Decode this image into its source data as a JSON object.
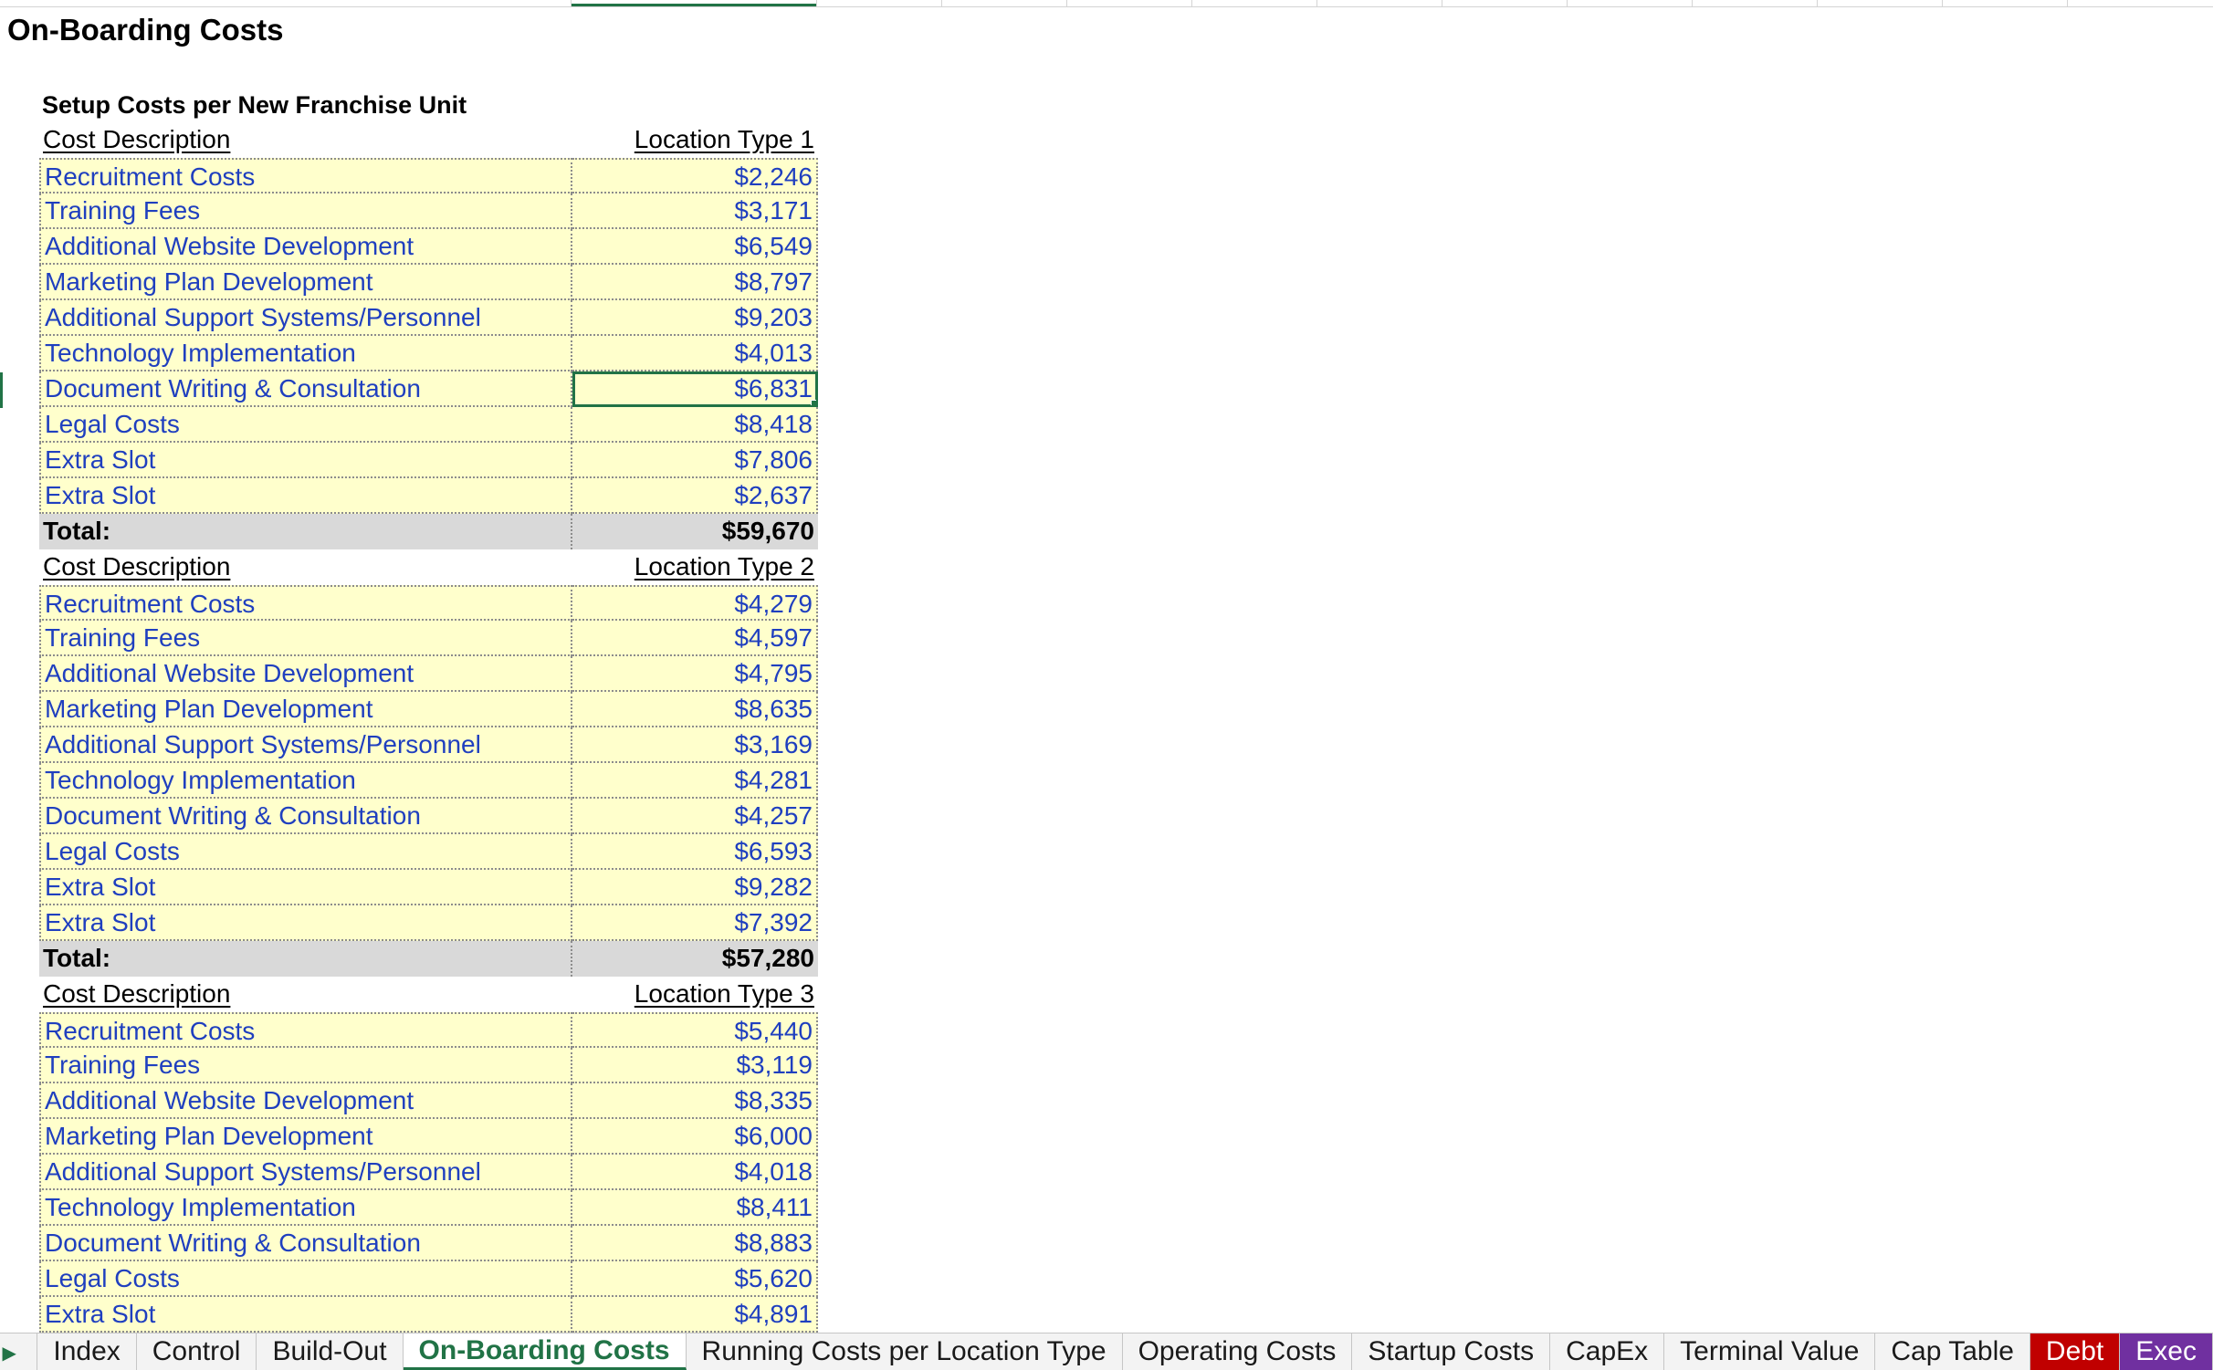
{
  "sheet": {
    "title": "On-Boarding Costs",
    "subtitle": "Setup Costs per New Franchise Unit"
  },
  "tables": [
    {
      "header": {
        "desc": "Cost Description",
        "value": "Location Type 1"
      },
      "rows": [
        {
          "desc": "Recruitment Costs",
          "value": "$2,246"
        },
        {
          "desc": "Training Fees",
          "value": "$3,171"
        },
        {
          "desc": "Additional Website Development",
          "value": "$6,549"
        },
        {
          "desc": "Marketing Plan Development",
          "value": "$8,797"
        },
        {
          "desc": "Additional Support Systems/Personnel",
          "value": "$9,203"
        },
        {
          "desc": "Technology Implementation",
          "value": "$4,013"
        },
        {
          "desc": "Document Writing & Consultation",
          "value": "$6,831"
        },
        {
          "desc": "Legal Costs",
          "value": "$8,418"
        },
        {
          "desc": "Extra Slot",
          "value": "$7,806"
        },
        {
          "desc": "Extra Slot",
          "value": "$2,637"
        }
      ],
      "total": {
        "label": "Total:",
        "value": "$59,670"
      }
    },
    {
      "header": {
        "desc": "Cost Description",
        "value": "Location Type 2"
      },
      "rows": [
        {
          "desc": "Recruitment Costs",
          "value": "$4,279"
        },
        {
          "desc": "Training Fees",
          "value": "$4,597"
        },
        {
          "desc": "Additional Website Development",
          "value": "$4,795"
        },
        {
          "desc": "Marketing Plan Development",
          "value": "$8,635"
        },
        {
          "desc": "Additional Support Systems/Personnel",
          "value": "$3,169"
        },
        {
          "desc": "Technology Implementation",
          "value": "$4,281"
        },
        {
          "desc": "Document Writing & Consultation",
          "value": "$4,257"
        },
        {
          "desc": "Legal Costs",
          "value": "$6,593"
        },
        {
          "desc": "Extra Slot",
          "value": "$9,282"
        },
        {
          "desc": "Extra Slot",
          "value": "$7,392"
        }
      ],
      "total": {
        "label": "Total:",
        "value": "$57,280"
      }
    },
    {
      "header": {
        "desc": "Cost Description",
        "value": "Location Type 3"
      },
      "rows": [
        {
          "desc": "Recruitment Costs",
          "value": "$5,440"
        },
        {
          "desc": "Training Fees",
          "value": "$3,119"
        },
        {
          "desc": "Additional Website Development",
          "value": "$8,335"
        },
        {
          "desc": "Marketing Plan Development",
          "value": "$6,000"
        },
        {
          "desc": "Additional Support Systems/Personnel",
          "value": "$4,018"
        },
        {
          "desc": "Technology Implementation",
          "value": "$8,411"
        },
        {
          "desc": "Document Writing & Consultation",
          "value": "$8,883"
        },
        {
          "desc": "Legal Costs",
          "value": "$5,620"
        },
        {
          "desc": "Extra Slot",
          "value": "$4,891"
        }
      ]
    }
  ],
  "selected_cell": {
    "table": 0,
    "row": 6
  },
  "tabs": [
    {
      "label": "Index",
      "style": "normal"
    },
    {
      "label": "Control",
      "style": "normal"
    },
    {
      "label": "Build-Out",
      "style": "normal"
    },
    {
      "label": "On-Boarding Costs",
      "style": "active"
    },
    {
      "label": "Running Costs per Location Type",
      "style": "normal"
    },
    {
      "label": "Operating Costs",
      "style": "normal"
    },
    {
      "label": "Startup Costs",
      "style": "normal"
    },
    {
      "label": "CapEx",
      "style": "normal"
    },
    {
      "label": "Terminal Value",
      "style": "normal"
    },
    {
      "label": "Cap Table",
      "style": "normal"
    },
    {
      "label": "Debt",
      "style": "red"
    },
    {
      "label": "Exec",
      "style": "purple"
    }
  ],
  "nav_icon": "play-right-icon",
  "colors": {
    "accent": "#217346",
    "input_bg": "#ffffcc",
    "input_text": "#1f3fbf",
    "total_bg": "#d9d9d9",
    "debt_tab": "#c00000",
    "exec_tab": "#7030a0"
  }
}
